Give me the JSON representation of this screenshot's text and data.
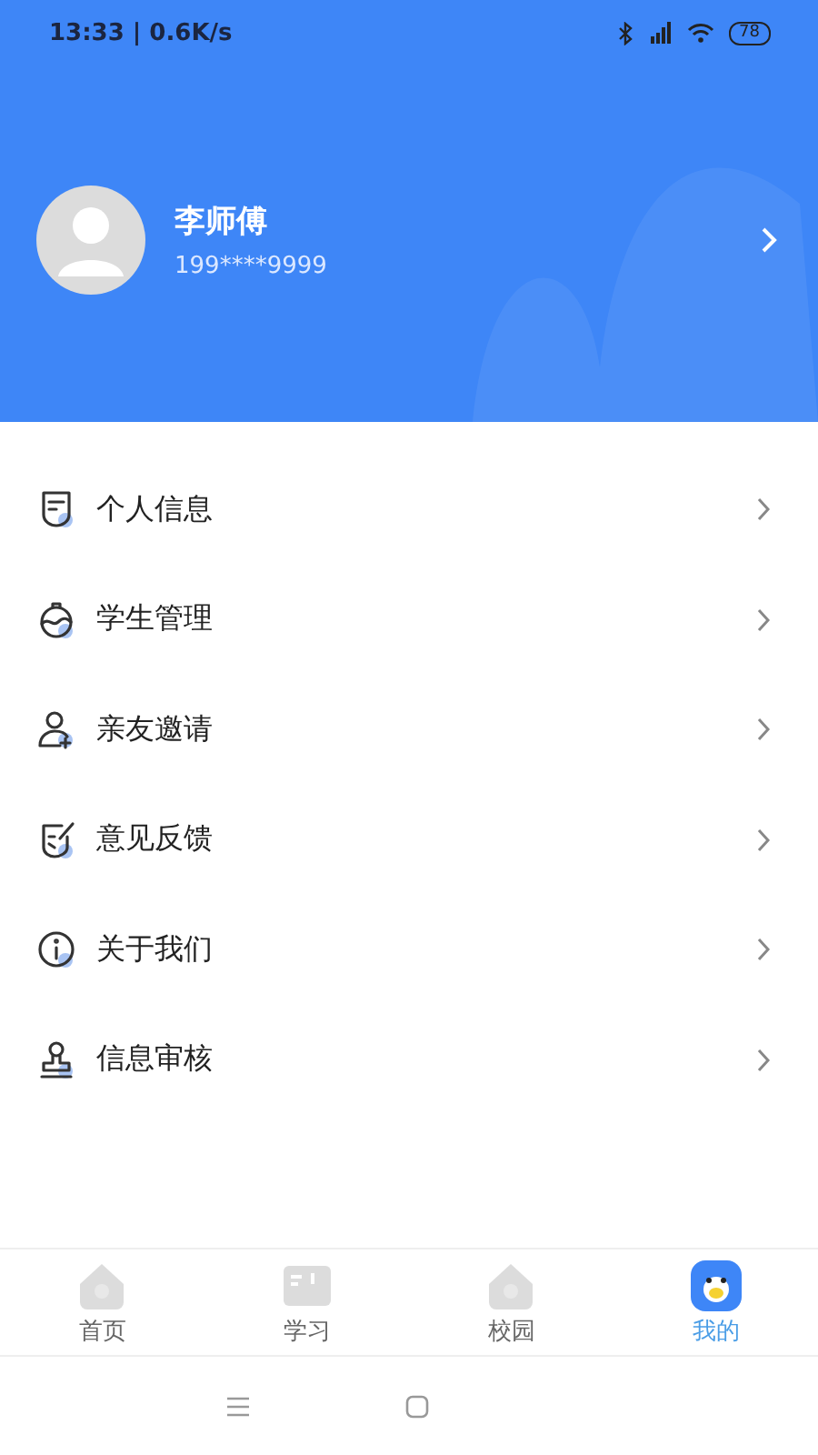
{
  "status_bar": {
    "time": "13:33 | 0.6K/s",
    "battery": "78"
  },
  "profile": {
    "name": "李师傅",
    "phone": "199****9999"
  },
  "menu": [
    {
      "label": "个人信息"
    },
    {
      "label": "学生管理"
    },
    {
      "label": "亲友邀请"
    },
    {
      "label": "意见反馈"
    },
    {
      "label": "关于我们"
    },
    {
      "label": "信息审核"
    }
  ],
  "tabs": [
    {
      "label": "首页",
      "selected": false
    },
    {
      "label": "学习",
      "selected": false
    },
    {
      "label": "校园",
      "selected": false
    },
    {
      "label": "我的",
      "selected": true
    }
  ]
}
